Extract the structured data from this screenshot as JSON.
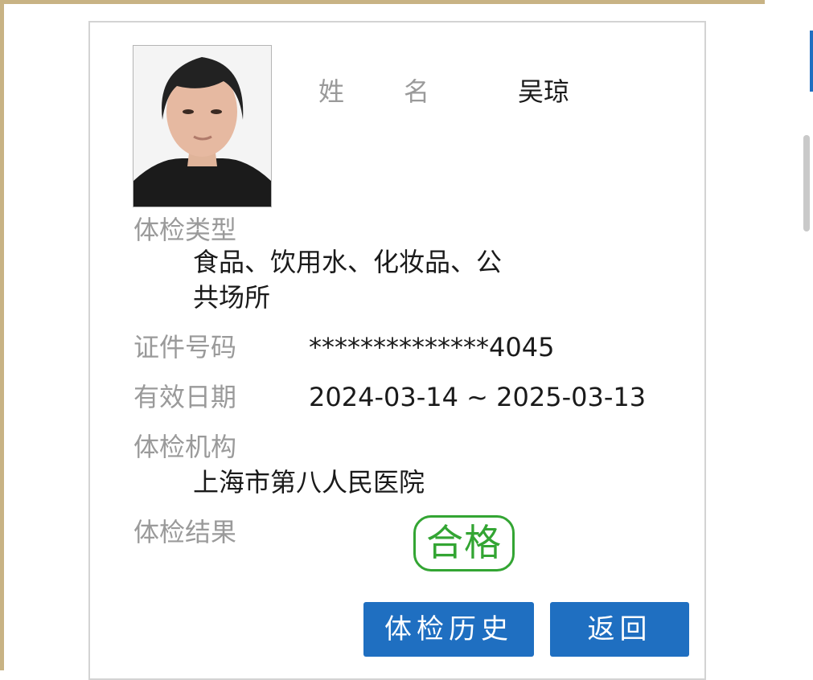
{
  "profile": {
    "name_label_part1": "姓",
    "name_label_part2": "名",
    "name_value": "吴琼",
    "exam_type_label": "体检类型",
    "exam_type_value_line1": "食品、饮用水、化妆品、公",
    "exam_type_value_line2": "共场所",
    "id_label": "证件号码",
    "id_value": "**************4045",
    "valid_label": "有效日期",
    "valid_value": "2024-03-14 ~ 2025-03-13",
    "org_label": "体检机构",
    "org_value": "上海市第八人民医院",
    "result_label": "体检结果",
    "result_stamp": "合格"
  },
  "actions": {
    "history_label": "体检历史",
    "back_label": "返回"
  },
  "colors": {
    "frame_border": "#c8b384",
    "button_blue": "#1f6fc1",
    "stamp_green": "#33a533",
    "label_gray": "#9a9a9a"
  },
  "icons": {
    "photo": "portrait-photo"
  }
}
